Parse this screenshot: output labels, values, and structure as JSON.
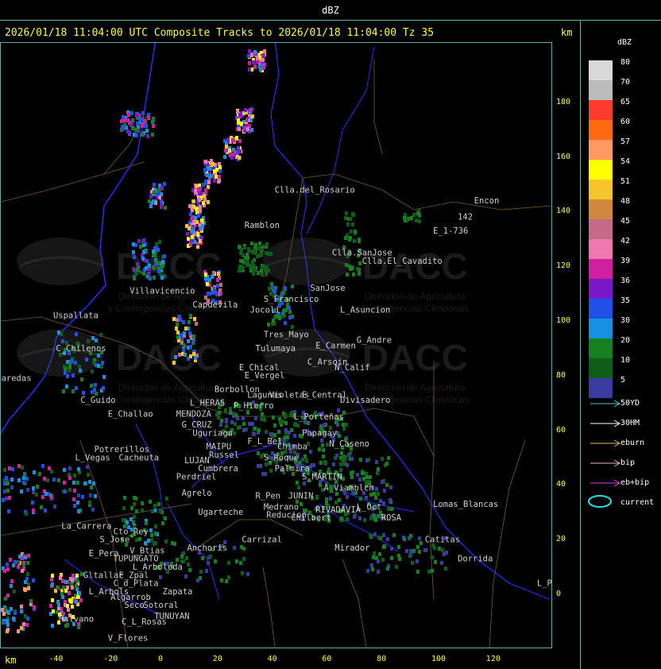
{
  "window_title": "dBZ",
  "headline": "2026/01/18 11:04:00 UTC Composite Tracks to 2026/01/18 11:04:00 Tz 35",
  "km_top": "km",
  "km_bottom": "km",
  "watermark": {
    "text": "DACC",
    "sub1": "Dirección de Agricultura",
    "sub2": "y Contingencias Climáticas"
  },
  "legend": {
    "title": "dBZ",
    "levels": [
      {
        "label": "80",
        "color": "#d8d8d8"
      },
      {
        "label": "70",
        "color": "#bcbcbc"
      },
      {
        "label": "65",
        "color": "#ff3a2a"
      },
      {
        "label": "60",
        "color": "#ff6a10"
      },
      {
        "label": "57",
        "color": "#ff9960"
      },
      {
        "label": "54",
        "color": "#ffff00"
      },
      {
        "label": "51",
        "color": "#f6c42c"
      },
      {
        "label": "48",
        "color": "#d2883c"
      },
      {
        "label": "45",
        "color": "#c46a88"
      },
      {
        "label": "42",
        "color": "#f078b0"
      },
      {
        "label": "39",
        "color": "#d020a0"
      },
      {
        "label": "36",
        "color": "#7a18c8"
      },
      {
        "label": "35",
        "color": "#2050e8"
      },
      {
        "label": "30",
        "color": "#1890e0"
      },
      {
        "label": "20",
        "color": "#148020"
      },
      {
        "label": "10",
        "color": "#0d5e18"
      },
      {
        "label": "5",
        "color": "#3a3aa0"
      }
    ]
  },
  "tracks": [
    {
      "label": "50YD",
      "color": "#40d0d0"
    },
    {
      "label": "30HM",
      "color": "#ffffff"
    },
    {
      "label": "eburn",
      "color": "#e0b070"
    },
    {
      "label": "bip",
      "color": "#f0b0c8"
    },
    {
      "label": "eb+bip",
      "color": "#e040e0"
    }
  ],
  "current_label": "current",
  "current_color": "#20e0e0",
  "axis": {
    "x_ticks": [
      "-40",
      "-20",
      "0",
      "20",
      "40",
      "60",
      "80",
      "100",
      "120"
    ],
    "y_ticks": [
      "180",
      "160",
      "140",
      "120",
      "100",
      "80",
      "60",
      "40",
      "20",
      "0"
    ]
  },
  "places": [
    {
      "name": "Clla.del_Rosario",
      "x": 40,
      "y": 147
    },
    {
      "name": "Encon",
      "x": 113,
      "y": 143
    },
    {
      "name": "142",
      "x": 107,
      "y": 137
    },
    {
      "name": "E_1-736",
      "x": 98,
      "y": 132
    },
    {
      "name": "Ramblon",
      "x": 29,
      "y": 134
    },
    {
      "name": "Clla.SanJose",
      "x": 61,
      "y": 124
    },
    {
      "name": "Clla.El_Cavadito",
      "x": 72,
      "y": 121
    },
    {
      "name": "Villavicencio",
      "x": -13,
      "y": 110
    },
    {
      "name": "S_Francisco",
      "x": 36,
      "y": 107
    },
    {
      "name": "SanJose",
      "x": 53,
      "y": 111
    },
    {
      "name": "Uspallata",
      "x": -41,
      "y": 101
    },
    {
      "name": "Capdevila",
      "x": 10,
      "y": 105
    },
    {
      "name": "Jocoli",
      "x": 31,
      "y": 103
    },
    {
      "name": "L_Asuncion",
      "x": 64,
      "y": 103
    },
    {
      "name": "Tres_Mayo",
      "x": 36,
      "y": 94
    },
    {
      "name": "G_Andre",
      "x": 70,
      "y": 92
    },
    {
      "name": "C_Chilenos",
      "x": -40,
      "y": 89
    },
    {
      "name": "Tulumaya",
      "x": 33,
      "y": 89
    },
    {
      "name": "E_Carmen",
      "x": 55,
      "y": 90
    },
    {
      "name": "C_Arsoin",
      "x": 52,
      "y": 84
    },
    {
      "name": "N_Calif",
      "x": 62,
      "y": 82
    },
    {
      "name": "E_Chical",
      "x": 27,
      "y": 82
    },
    {
      "name": "E_Vergel",
      "x": 29,
      "y": 79
    },
    {
      "name": "aredas",
      "x": -60,
      "y": 78
    },
    {
      "name": "Borbollon",
      "x": 18,
      "y": 74
    },
    {
      "name": "Lagunas",
      "x": 30,
      "y": 72
    },
    {
      "name": "Violetas",
      "x": 38,
      "y": 72
    },
    {
      "name": "E_Central",
      "x": 50,
      "y": 72
    },
    {
      "name": "Divisadero",
      "x": 64,
      "y": 70
    },
    {
      "name": "C_Guido",
      "x": -31,
      "y": 70
    },
    {
      "name": "L_HERAS",
      "x": 9,
      "y": 69
    },
    {
      "name": "P_Hierro",
      "x": 25,
      "y": 68
    },
    {
      "name": "E_Challao",
      "x": -21,
      "y": 65
    },
    {
      "name": "MENDOZA",
      "x": 4,
      "y": 65
    },
    {
      "name": "L_Porteñas",
      "x": 47,
      "y": 64
    },
    {
      "name": "G_CRUZ",
      "x": 6,
      "y": 61
    },
    {
      "name": "Uguriaga",
      "x": 10,
      "y": 58
    },
    {
      "name": "F_L_Bel",
      "x": 30,
      "y": 55
    },
    {
      "name": "Chimba",
      "x": 41,
      "y": 53
    },
    {
      "name": "Papagay",
      "x": 50,
      "y": 58
    },
    {
      "name": "Potrerillos",
      "x": -26,
      "y": 52
    },
    {
      "name": "MAIPU",
      "x": 15,
      "y": 53
    },
    {
      "name": "N_Caseno",
      "x": 60,
      "y": 54
    },
    {
      "name": "L_Vegas",
      "x": -33,
      "y": 49
    },
    {
      "name": "Cacheuta",
      "x": -17,
      "y": 49
    },
    {
      "name": "Russel",
      "x": 16,
      "y": 50
    },
    {
      "name": "S_Roque",
      "x": 36,
      "y": 49
    },
    {
      "name": "LUJAN",
      "x": 7,
      "y": 48
    },
    {
      "name": "Cumbrera",
      "x": 12,
      "y": 45
    },
    {
      "name": "Palmira",
      "x": 40,
      "y": 45
    },
    {
      "name": "Perdriel",
      "x": 4,
      "y": 42
    },
    {
      "name": "S_MARTIN",
      "x": 50,
      "y": 42
    },
    {
      "name": "Agrelo",
      "x": 6,
      "y": 36
    },
    {
      "name": "A_Viamblch",
      "x": 58,
      "y": 38
    },
    {
      "name": "R_Pen",
      "x": 33,
      "y": 35
    },
    {
      "name": "JUNIN",
      "x": 45,
      "y": 35
    },
    {
      "name": "Lomas_Blancas",
      "x": 98,
      "y": 32
    },
    {
      "name": "Ugarteche",
      "x": 12,
      "y": 29
    },
    {
      "name": "RIVADAVIA",
      "x": 55,
      "y": 30
    },
    {
      "name": "L_Oct",
      "x": 70,
      "y": 31
    },
    {
      "name": "Medrano",
      "x": 36,
      "y": 31
    },
    {
      "name": "Reducion",
      "x": 37,
      "y": 28
    },
    {
      "name": "Chilbert",
      "x": 46,
      "y": 27
    },
    {
      "name": "ROSA",
      "x": 79,
      "y": 27
    },
    {
      "name": "La_Carrera",
      "x": -38,
      "y": 24
    },
    {
      "name": "Cto_Rey",
      "x": -19,
      "y": 22
    },
    {
      "name": "S_Jose",
      "x": -24,
      "y": 19
    },
    {
      "name": "Carrizal",
      "x": 28,
      "y": 19
    },
    {
      "name": "Catitas",
      "x": 95,
      "y": 19
    },
    {
      "name": "Mirador",
      "x": 62,
      "y": 16
    },
    {
      "name": "Anchoris",
      "x": 8,
      "y": 16
    },
    {
      "name": "V_Btias",
      "x": -13,
      "y": 15
    },
    {
      "name": "E_Pera",
      "x": -28,
      "y": 14
    },
    {
      "name": "TUPUNGATO",
      "x": -19,
      "y": 12
    },
    {
      "name": "Dorrida",
      "x": 107,
      "y": 12
    },
    {
      "name": "L_Arboleda",
      "x": -12,
      "y": 9
    },
    {
      "name": "E_Zpal",
      "x": -17,
      "y": 6
    },
    {
      "name": "Gltallar",
      "x": -30,
      "y": 6
    },
    {
      "name": "C_d_Plata",
      "x": -19,
      "y": 3
    },
    {
      "name": "L_PAZ",
      "x": 136,
      "y": 3
    },
    {
      "name": "L_Arbols",
      "x": -28,
      "y": 0
    },
    {
      "name": "Zapata",
      "x": -1,
      "y": 0
    },
    {
      "name": "Algarrob",
      "x": -20,
      "y": -2
    },
    {
      "name": "Seco",
      "x": -15,
      "y": -5
    },
    {
      "name": "Sotoral",
      "x": -8,
      "y": -5
    },
    {
      "name": "TUNUYAN",
      "x": -4,
      "y": -9
    },
    {
      "name": "Malvano",
      "x": -39,
      "y": -10
    },
    {
      "name": "C_L_Rosas",
      "x": -16,
      "y": -11
    },
    {
      "name": "V_Flores",
      "x": -21,
      "y": -17
    }
  ]
}
